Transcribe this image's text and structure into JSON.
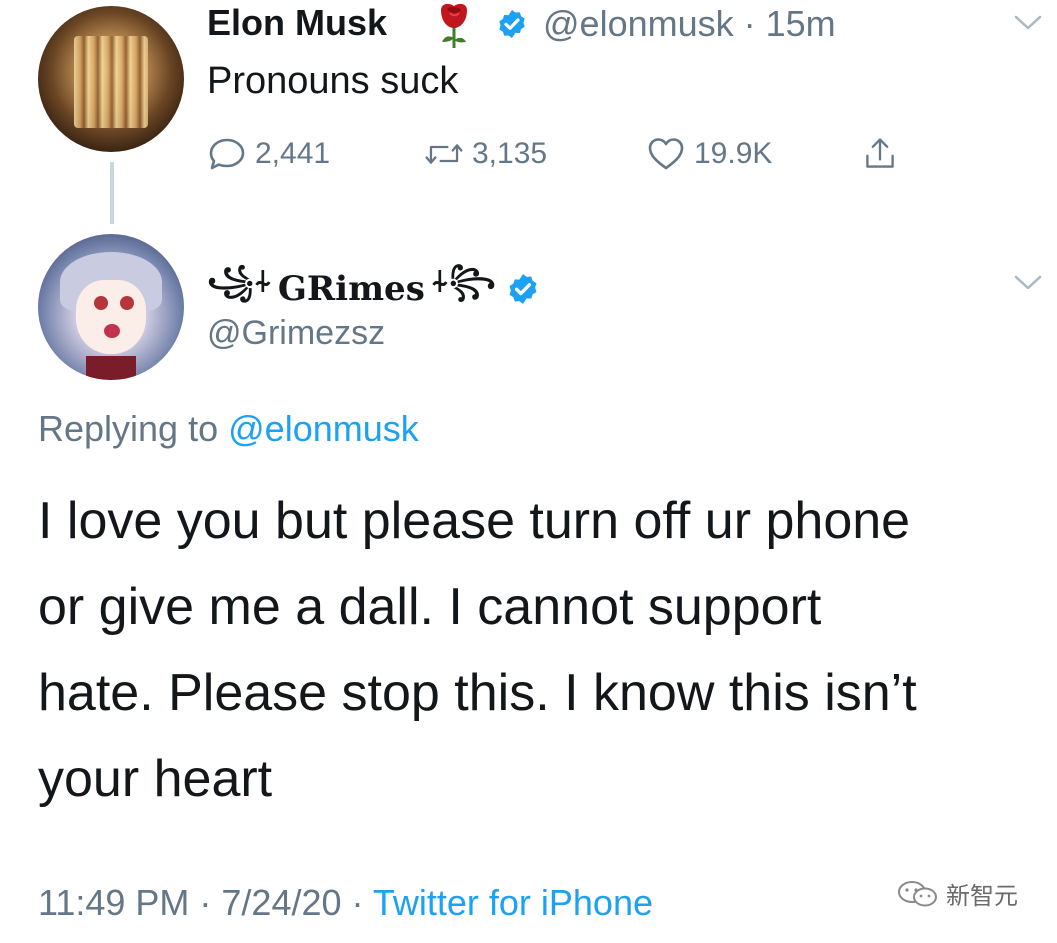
{
  "parent_tweet": {
    "author_name": "Elon Musk",
    "handle_time": "@elonmusk · 15m",
    "text": "Pronouns suck",
    "stats": {
      "replies": "2,441",
      "retweets": "3,135",
      "likes": "19.9K"
    }
  },
  "reply_tweet": {
    "ornament_left": "꧁⍭",
    "author_name": "GRimes",
    "ornament_right": "⍭꧂",
    "handle": "@Grimezsz",
    "replying_prefix": "Replying to",
    "replying_to": "@elonmusk",
    "text_lines": [
      "I love you but please turn off ur phone",
      "or give me a dall.  I cannot support",
      "hate.  Please stop this. I know this isn’t",
      "your heart"
    ],
    "timestamp": "11:49 PM · 7/24/20 ·",
    "source": "Twitter for iPhone"
  },
  "watermark": {
    "text": "新智元"
  },
  "colors": {
    "text": "#14171a",
    "secondary": "#657786",
    "link": "#1da1f2",
    "verified": "#1da1f2",
    "thread_line": "#ccd6dd"
  },
  "icons": {
    "reply": "reply-icon",
    "retweet": "retweet-icon",
    "like": "heart-icon",
    "share": "share-icon",
    "verified": "verified-badge-icon",
    "more": "chevron-down-icon",
    "emoji": "rose-icon"
  }
}
